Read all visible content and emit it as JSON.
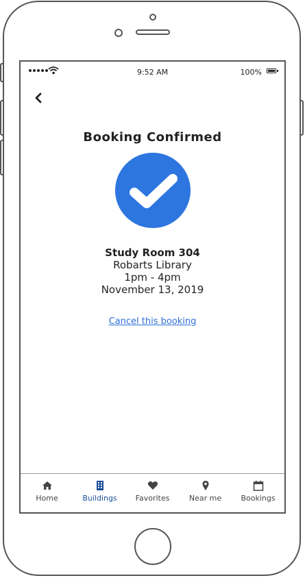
{
  "status_bar": {
    "time": "9:52 AM",
    "battery": "100%"
  },
  "page": {
    "title": "Booking Confirmed"
  },
  "booking": {
    "room": "Study Room 304",
    "building": "Robarts Library",
    "time_range": "1pm - 4pm",
    "date": "November 13, 2019",
    "cancel_label": "Cancel this booking"
  },
  "tabbar": {
    "active_color": "#1b4f9a",
    "items": [
      {
        "label": "Home",
        "icon": "home-icon",
        "active": false
      },
      {
        "label": "Buildings",
        "icon": "building-icon",
        "active": true
      },
      {
        "label": "Favorites",
        "icon": "heart-icon",
        "active": false
      },
      {
        "label": "Near me",
        "icon": "location-pin-icon",
        "active": false
      },
      {
        "label": "Bookings",
        "icon": "calendar-icon",
        "active": false
      }
    ]
  },
  "colors": {
    "accent": "#2d76e0",
    "link": "#2d6fd6"
  }
}
